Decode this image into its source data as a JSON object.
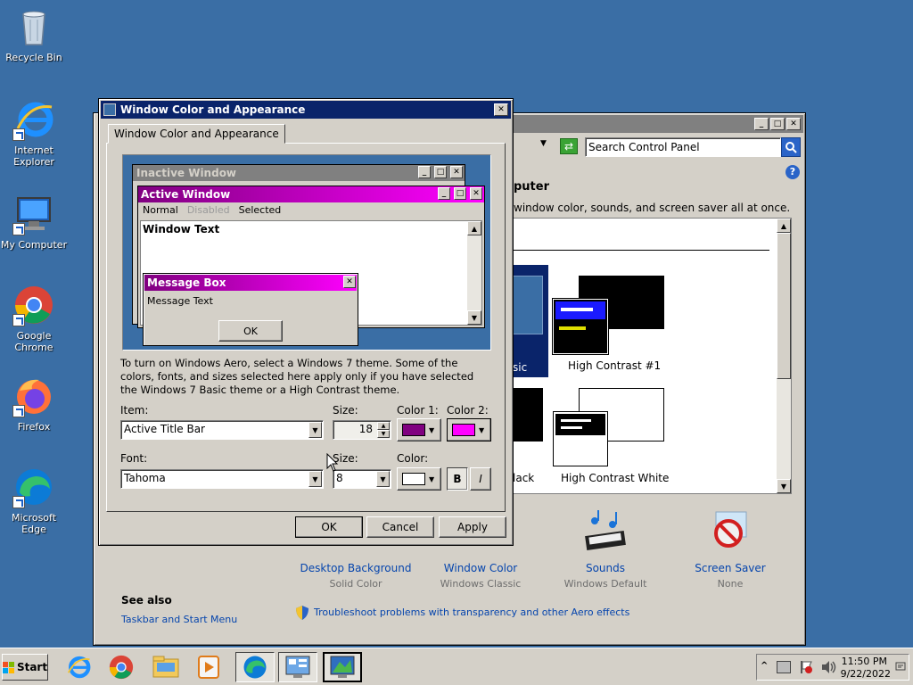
{
  "desktop": {
    "icons": [
      {
        "label": "Recycle Bin",
        "icon": "recycle-bin-icon"
      },
      {
        "label": "Internet Explorer",
        "icon": "internet-explorer-icon"
      },
      {
        "label": "My Computer",
        "icon": "my-computer-icon"
      },
      {
        "label": "Google Chrome",
        "icon": "chrome-icon"
      },
      {
        "label": "Firefox",
        "icon": "firefox-icon"
      },
      {
        "label": "Microsoft Edge",
        "icon": "edge-icon"
      }
    ]
  },
  "control_panel": {
    "search_placeholder": "Search Control Panel",
    "heading_partial": "puter",
    "desc_partial": "window color, sounds, and screen saver all at once.",
    "theme_partial_basic": "sic",
    "theme_partial_black": "lack",
    "themes": [
      {
        "label": "High Contrast #1"
      },
      {
        "label": "High Contrast White"
      }
    ],
    "bottom_items": [
      {
        "label": "Desktop Background",
        "sub": "Solid Color"
      },
      {
        "label": "Window Color",
        "sub": "Windows Classic"
      },
      {
        "label": "Sounds",
        "sub": "Windows Default"
      },
      {
        "label": "Screen Saver",
        "sub": "None"
      }
    ],
    "see_also_title": "See also",
    "see_also_link": "Taskbar and Start Menu",
    "troubleshoot_link": "Troubleshoot problems with transparency and other Aero effects"
  },
  "dialog": {
    "title": "Window Color and Appearance",
    "tab": "Window Color and Appearance",
    "preview": {
      "inactive_title": "Inactive Window",
      "active_title": "Active Window",
      "menu": [
        "Normal",
        "Disabled",
        "Selected"
      ],
      "window_text": "Window Text",
      "msgbox_title": "Message Box",
      "msgbox_text": "Message Text",
      "msgbox_ok": "OK"
    },
    "info_text": "To turn on Windows Aero, select a Windows 7 theme.  Some of the colors, fonts, and sizes selected here apply only if you have selected the Windows 7 Basic theme or a High Contrast theme.",
    "item_label": "Item:",
    "item_value": "Active Title Bar",
    "size_label": "Size:",
    "size_value": "18",
    "color1_label": "Color 1:",
    "color2_label": "Color 2:",
    "color1": "#800080",
    "color2": "#ff00ff",
    "font_label": "Font:",
    "font_value": "Tahoma",
    "font_size_label": "Size:",
    "font_size_value": "8",
    "font_color_label": "Color:",
    "font_color": "#ffffff",
    "bold_label": "B",
    "italic_label": "I",
    "ok": "OK",
    "cancel": "Cancel",
    "apply": "Apply"
  },
  "taskbar": {
    "start_label": "Start",
    "time": "11:50 PM",
    "date": "9/22/2022",
    "apps": [
      "internet-explorer-icon",
      "chrome-icon",
      "explorer-folder-icon",
      "media-player-icon",
      "edge-icon",
      "control-panel-icon",
      "display-settings-icon"
    ]
  }
}
